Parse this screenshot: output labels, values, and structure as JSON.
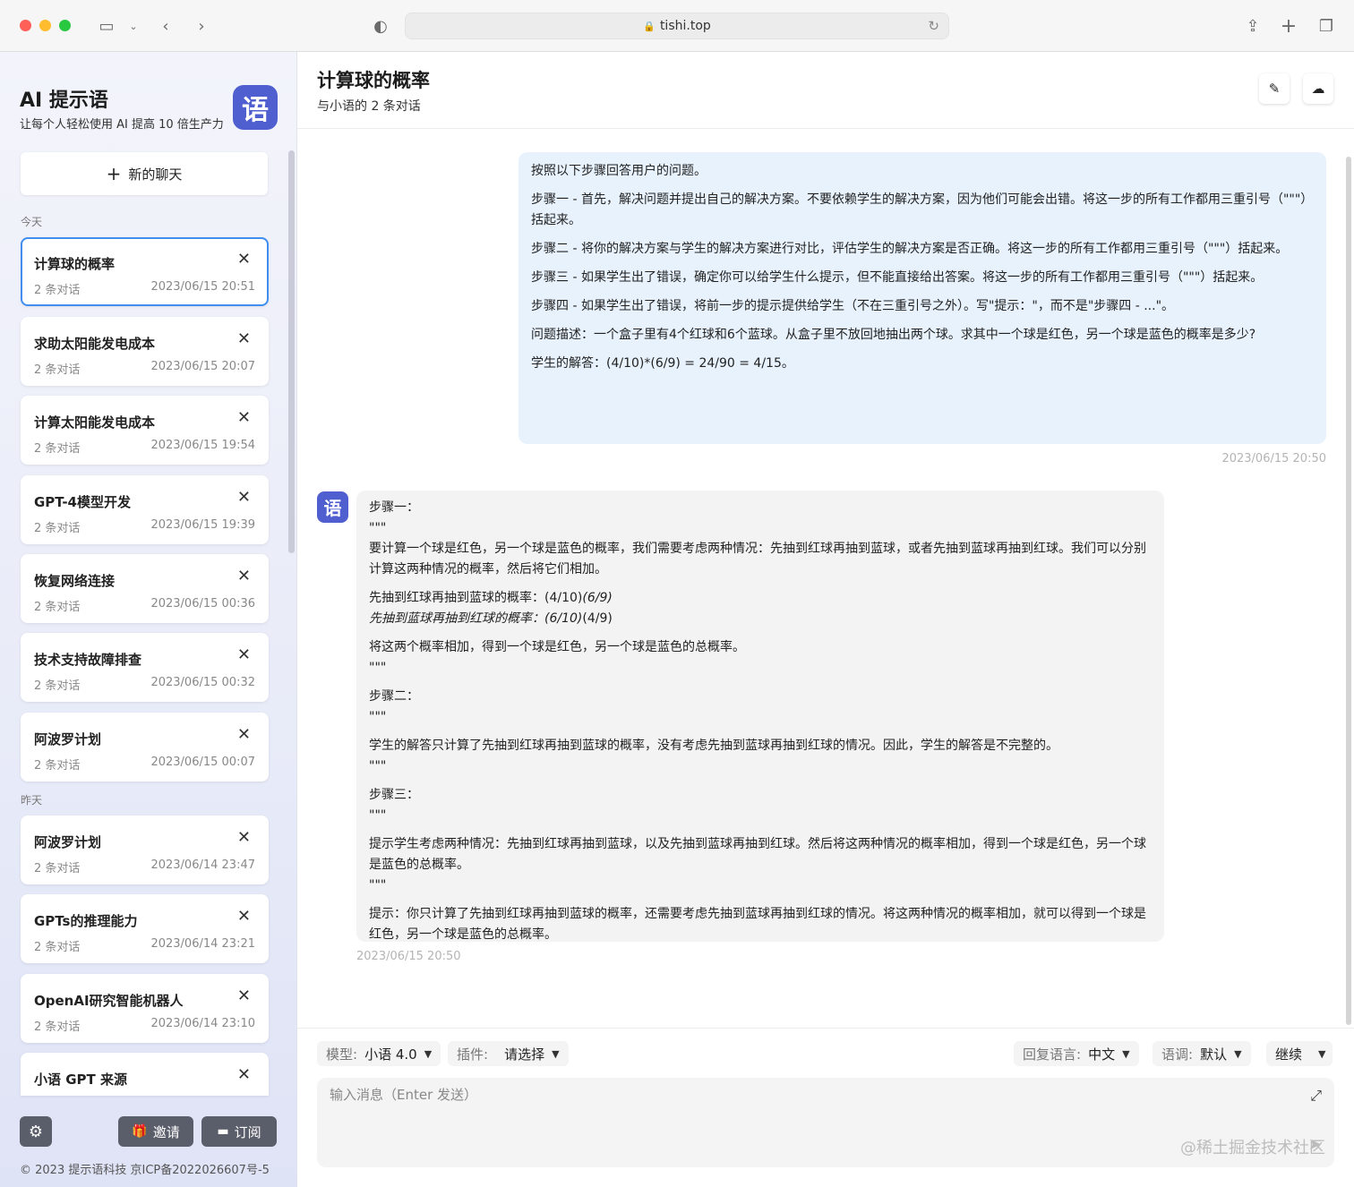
{
  "browser": {
    "url": "tishi.top"
  },
  "sidebar": {
    "brand_title": "AI 提示语",
    "brand_subtitle": "让每个人轻松使用 AI 提高 10 倍生产力",
    "logo_char": "语",
    "new_chat_label": "新的聊天",
    "group_today": "今天",
    "group_yesterday": "昨天",
    "chats": [
      {
        "title": "计算球的概率",
        "count": "2 条对话",
        "time": "2023/06/15 20:51"
      },
      {
        "title": "求助太阳能发电成本",
        "count": "2 条对话",
        "time": "2023/06/15 20:07"
      },
      {
        "title": "计算太阳能发电成本",
        "count": "2 条对话",
        "time": "2023/06/15 19:54"
      },
      {
        "title": "GPT-4模型开发",
        "count": "2 条对话",
        "time": "2023/06/15 19:39"
      },
      {
        "title": "恢复网络连接",
        "count": "2 条对话",
        "time": "2023/06/15 00:36"
      },
      {
        "title": "技术支持故障排查",
        "count": "2 条对话",
        "time": "2023/06/15 00:32"
      },
      {
        "title": "阿波罗计划",
        "count": "2 条对话",
        "time": "2023/06/15 00:07"
      },
      {
        "title": "阿波罗计划",
        "count": "2 条对话",
        "time": "2023/06/14 23:47"
      },
      {
        "title": "GPTs的推理能力",
        "count": "2 条对话",
        "time": "2023/06/14 23:21"
      },
      {
        "title": "OpenAI研究智能机器人",
        "count": "2 条对话",
        "time": "2023/06/14 23:10"
      },
      {
        "title": "小语 GPT 来源",
        "count": "",
        "time": ""
      }
    ],
    "invite_label": "邀请",
    "subscribe_label": "订阅",
    "footer": "© 2023 提示语科技   京ICP备2022026607号-5"
  },
  "header": {
    "title": "计算球的概率",
    "subtitle": "与小语的 2 条对话"
  },
  "messages": {
    "user": {
      "paragraphs": [
        "按照以下步骤回答用户的问题。",
        "步骤一 - 首先，解决问题并提出自己的解决方案。不要依赖学生的解决方案，因为他们可能会出错。将这一步的所有工作都用三重引号（\"\"\"）括起来。",
        "步骤二 - 将你的解决方案与学生的解决方案进行对比，评估学生的解决方案是否正确。将这一步的所有工作都用三重引号（\"\"\"）括起来。",
        "步骤三 - 如果学生出了错误，确定你可以给学生什么提示，但不能直接给出答案。将这一步的所有工作都用三重引号（\"\"\"）括起来。",
        "步骤四 - 如果学生出了错误，将前一步的提示提供给学生（不在三重引号之外）。写\"提示：\"，而不是\"步骤四 - ...\"。",
        "问题描述：一个盒子里有4个红球和6个蓝球。从盒子里不放回地抽出两个球。求其中一个球是红色，另一个球是蓝色的概率是多少?",
        "学生的解答：(4/10)*(6/9) = 24/90 = 4/15。"
      ],
      "time": "2023/06/15 20:50"
    },
    "bot": {
      "avatar_char": "语",
      "lines": {
        "l1": "步骤一：",
        "l2": "\"\"\"",
        "l3": "要计算一个球是红色，另一个球是蓝色的概率，我们需要考虑两种情况：先抽到红球再抽到蓝球，或者先抽到蓝球再抽到红球。我们可以分别计算这两种情况的概率，然后将它们相加。",
        "l4a": "先抽到红球再抽到蓝球的概率：(4/10)",
        "l4b": "(6/9)",
        "l5a": "先抽到蓝球再抽到红球的概率：(6/10)",
        "l5b": "(4/9)",
        "l6": "将这两个概率相加，得到一个球是红色，另一个球是蓝色的总概率。",
        "l7": "\"\"\"",
        "l8": "步骤二：",
        "l9": "\"\"\"",
        "l10": "学生的解答只计算了先抽到红球再抽到蓝球的概率，没有考虑先抽到蓝球再抽到红球的情况。因此，学生的解答是不完整的。",
        "l11": "\"\"\"",
        "l12": "步骤三：",
        "l13": "\"\"\"",
        "l14": "提示学生考虑两种情况：先抽到红球再抽到蓝球，以及先抽到蓝球再抽到红球。然后将这两种情况的概率相加，得到一个球是红色，另一个球是蓝色的总概率。",
        "l15": "\"\"\"",
        "l16": "提示：你只计算了先抽到红球再抽到蓝球的概率，还需要考虑先抽到蓝球再抽到红球的情况。将这两种情况的概率相加，就可以得到一个球是红色，另一个球是蓝色的总概率。"
      },
      "time": "2023/06/15 20:50"
    }
  },
  "composer": {
    "model_label": "模型:",
    "model_value": "小语 4.0",
    "plugin_label": "插件:",
    "plugin_value": "请选择",
    "reply_lang_label": "回复语言:",
    "reply_lang_value": "中文",
    "tone_label": "语调:",
    "tone_value": "默认",
    "continue_label": "继续",
    "placeholder": "输入消息（Enter 发送）"
  },
  "watermark": "@稀土掘金技术社区"
}
